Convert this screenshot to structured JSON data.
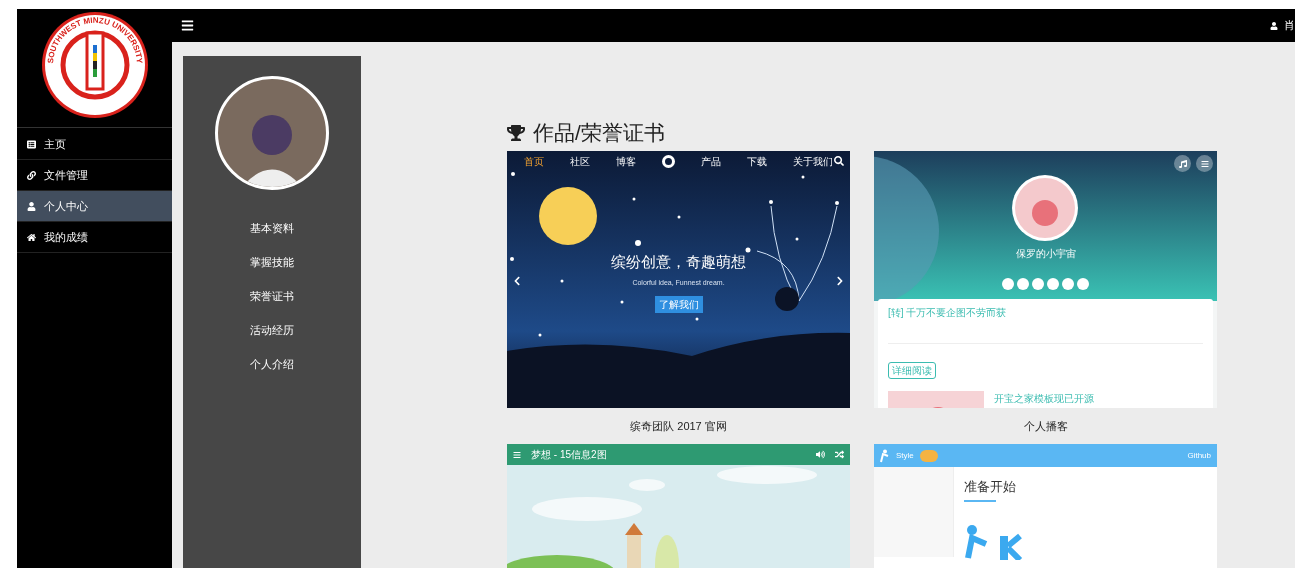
{
  "logo": {
    "text": "SOUTHWEST MINZU UNIVERSITY"
  },
  "sidebar": {
    "items": [
      {
        "label": "主页",
        "selected": false
      },
      {
        "label": "文件管理",
        "selected": false
      },
      {
        "label": "个人中心",
        "selected": true
      },
      {
        "label": "我的成绩",
        "selected": false
      }
    ]
  },
  "topbar": {
    "user": "肖"
  },
  "profile_menu": [
    "基本资料",
    "掌握技能",
    "荣誉证书",
    "活动经历",
    "个人介绍"
  ],
  "section_title": "作品/荣誉证书",
  "works": [
    {
      "kind": "starry",
      "caption": "缤奇团队 2017 官网",
      "nav": [
        "首页",
        "社区",
        "博客",
        "产品",
        "下载",
        "关于我们"
      ],
      "headline": "缤纷创意，奇趣萌想",
      "subtitle": "Colorful idea, Funnest dream.",
      "button": "了解我们"
    },
    {
      "kind": "blog",
      "caption": "个人播客",
      "name": "保罗的小宇宙",
      "post_title": "[转] 千万不要企图不劳而获",
      "button": "详细阅读",
      "post_title_2": "开宝之家模板现已开源"
    },
    {
      "kind": "music",
      "title": "梦想 - 15信息2图"
    },
    {
      "kind": "docs",
      "brand": "Style",
      "links": [
        "Github"
      ],
      "heading": "准备开始"
    }
  ]
}
